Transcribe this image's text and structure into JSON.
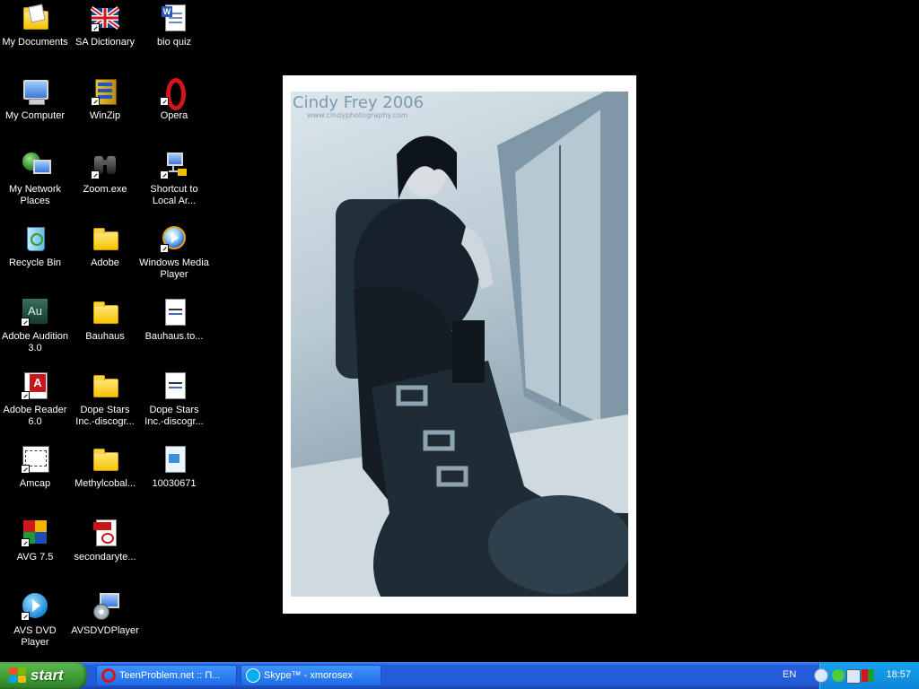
{
  "desktop": {
    "icons": [
      {
        "label": "My Documents",
        "icon": "my-documents-icon"
      },
      {
        "label": "SA Dictionary",
        "icon": "uk-flag-icon"
      },
      {
        "label": "bio quiz",
        "icon": "word-document-icon"
      },
      {
        "label": "My Computer",
        "icon": "my-computer-icon"
      },
      {
        "label": "WinZip",
        "icon": "winzip-icon"
      },
      {
        "label": "Opera",
        "icon": "opera-icon"
      },
      {
        "label": "My Network Places",
        "icon": "network-places-icon"
      },
      {
        "label": "Zoom.exe",
        "icon": "binoculars-icon"
      },
      {
        "label": "Shortcut to Local Ar...",
        "icon": "network-share-icon"
      },
      {
        "label": "Recycle Bin",
        "icon": "recycle-bin-icon"
      },
      {
        "label": "Adobe",
        "icon": "folder-icon"
      },
      {
        "label": "Windows Media Player",
        "icon": "media-player-icon"
      },
      {
        "label": "Adobe Audition 3.0",
        "icon": "audition-icon"
      },
      {
        "label": "Bauhaus",
        "icon": "folder-icon"
      },
      {
        "label": "Bauhaus.to...",
        "icon": "torrent-file-icon"
      },
      {
        "label": "Adobe Reader 6.0",
        "icon": "adobe-reader-icon"
      },
      {
        "label": "Dope Stars Inc.-discogr...",
        "icon": "folder-icon"
      },
      {
        "label": "Dope Stars Inc.-discogr...",
        "icon": "torrent-file-icon"
      },
      {
        "label": "Amcap",
        "icon": "amcap-icon"
      },
      {
        "label": "Methylcobal...",
        "icon": "folder-icon"
      },
      {
        "label": "10030671",
        "icon": "file-icon"
      },
      {
        "label": "AVG 7.5",
        "icon": "avg-icon"
      },
      {
        "label": "secondaryte...",
        "icon": "pdf-icon"
      },
      {
        "label": "AVS DVD Player",
        "icon": "avs-dvd-icon"
      },
      {
        "label": "AVSDVDPlayer",
        "icon": "avs-setup-icon"
      }
    ]
  },
  "photo": {
    "watermark_title": "Cindy Frey 2006",
    "watermark_url": "www.cindyphotography.com"
  },
  "taskbar": {
    "start_label": "start",
    "tasks": [
      {
        "label": "TeenProblem.net :: П...",
        "icon": "opera-icon"
      },
      {
        "label": "Skype™ - xmorosex",
        "icon": "skype-icon"
      }
    ],
    "language": "EN",
    "clock": "18:57"
  },
  "colors": {
    "taskbar": "#245edc",
    "start": "#3c9a33",
    "tray": "#0e86da"
  }
}
